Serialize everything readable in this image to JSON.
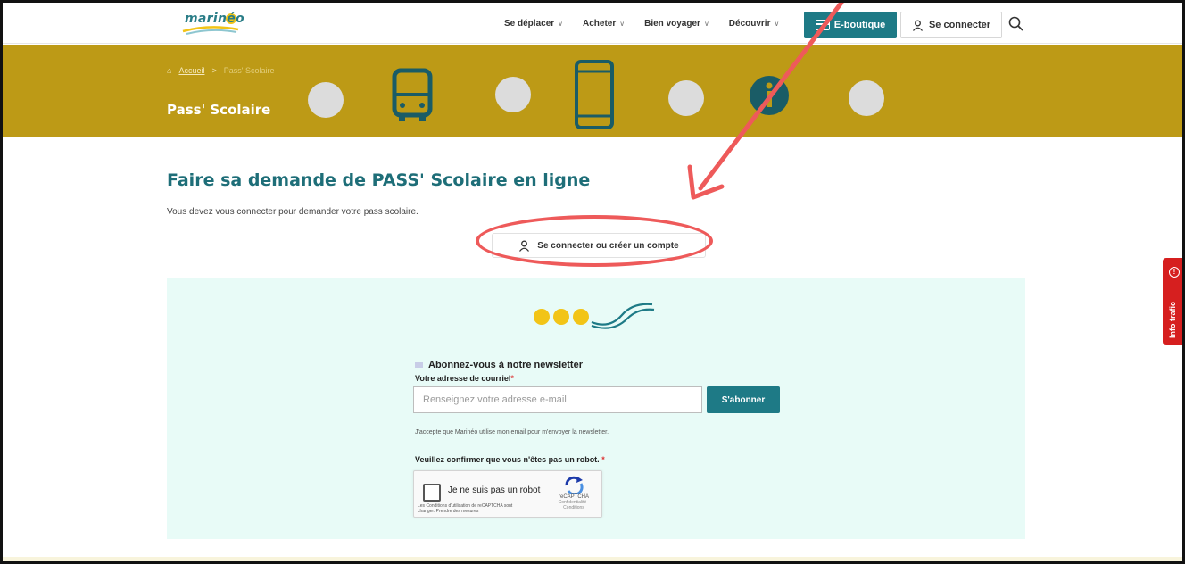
{
  "header": {
    "logo_text": "marinéo",
    "nav": [
      {
        "label": "Se déplacer",
        "chevron": "chevron-down-icon"
      },
      {
        "label": "Acheter",
        "chevron": "chevron-down-icon"
      },
      {
        "label": "Bien voyager",
        "chevron": "chevron-down-icon"
      },
      {
        "label": "Découvrir",
        "chevron": "chevron-down-icon"
      }
    ],
    "eboutique_label": "E-boutique",
    "login_label": "Se connecter"
  },
  "banner": {
    "breadcrumb_home": "Accueil",
    "breadcrumb_sep": ">",
    "breadcrumb_current": "Pass' Scolaire",
    "title": "Pass' Scolaire"
  },
  "main": {
    "title": "Faire sa demande de PASS' Scolaire en ligne",
    "description": "Vous devez vous connecter pour demander votre pass scolaire.",
    "connect_button": "Se connecter ou créer un compte"
  },
  "newsletter": {
    "title": "Abonnez-vous à notre newsletter",
    "email_label": "Votre adresse de courriel",
    "required_mark": "*",
    "email_placeholder": "Renseignez votre adresse e-mail",
    "email_value": "",
    "subscribe_label": "S'abonner",
    "consent": "J'accepte que Marinéo utilise mon email pour m'envoyer la newsletter.",
    "robot_question": "Veuillez confirmer que vous n'êtes pas un robot.",
    "captcha_label": "Je ne suis pas un robot",
    "captcha_terms": "Les Conditions d'utilisation de reCAPTCHA sont changer. Prendre des mesures",
    "captcha_brand": "reCAPTCHA",
    "captcha_links": "Confidentialité - Conditions"
  },
  "side_tab": {
    "label": "Info trafic"
  },
  "colors": {
    "brand_teal": "#1e7a86",
    "banner_gold": "#bd9a16",
    "newsletter_bg": "#e8fbf7",
    "annotation_red": "#ee5a5a",
    "info_red": "#d61f1f"
  }
}
